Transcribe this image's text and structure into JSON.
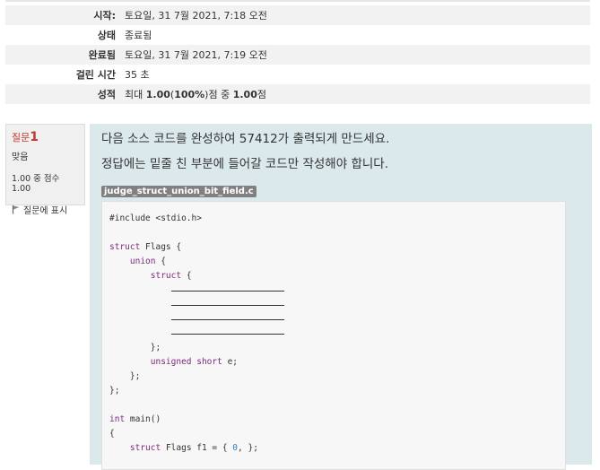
{
  "summary": [
    {
      "label": "시작:",
      "value": "토요일, 31 7월 2021, 7:18 오전"
    },
    {
      "label": "상태",
      "value": "종료됨"
    },
    {
      "label": "완료됨",
      "value": "토요일, 31 7월 2021, 7:19 오전"
    },
    {
      "label": "걸린 시간",
      "value": "35 초"
    },
    {
      "label": "성적",
      "value_prefix": "최대 ",
      "value_bold1": "1.00",
      "value_mid": "(",
      "value_bold2": "100%",
      "value_mid2": ")점 중 ",
      "value_bold3": "1.00",
      "value_suffix": "점"
    }
  ],
  "question": {
    "label": "질문",
    "number": "1",
    "state": "맞음",
    "grade": "1.00 중 점수 1.00",
    "flag_label": "질문에 표시",
    "text_line1": "다음 소스 코드를 완성하여 57412가 출력되게 만드세요.",
    "text_line2": "정답에는 밑줄 친 부분에 들어갈 코드만 작성해야 합니다.",
    "filename": "judge_struct_union_bit_field.c"
  },
  "code": {
    "include": "#include <stdio.h>",
    "struct_kw": "struct",
    "struct_name": " Flags {",
    "union_kw": "union",
    "union_rest": " {",
    "struct2_kw": "struct",
    "struct2_rest": " {",
    "close_inner": "};",
    "unsigned_kw": "unsigned short",
    "unsigned_rest": " e;",
    "close_union": "};",
    "close_struct": "};",
    "int_kw": "int",
    "main_rest": " main()",
    "open_brace": "{",
    "decl_kw": "struct",
    "decl_mid": " Flags f1 = { ",
    "decl_num": "0",
    "decl_end": ", };"
  }
}
